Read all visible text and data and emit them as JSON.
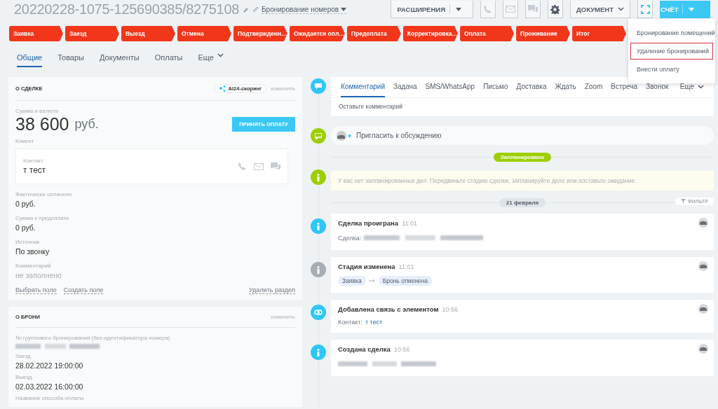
{
  "header": {
    "title": "20220228-1075-125690385/8275108",
    "category": "Бронирование номеров",
    "buttons": [
      {
        "kind": "split",
        "label": "РАСШИРЕНИЯ"
      },
      {
        "kind": "phone"
      },
      {
        "kind": "mail"
      },
      {
        "kind": "chat"
      },
      {
        "kind": "gear"
      },
      {
        "kind": "menu",
        "label": "ДОКУМЕНТ"
      },
      {
        "kind": "scan"
      },
      {
        "kind": "primary",
        "label": "СЧЁТ"
      }
    ]
  },
  "stages": [
    {
      "label": "Заявка"
    },
    {
      "label": "Заезд"
    },
    {
      "label": "Выезд"
    },
    {
      "label": "Отмена"
    },
    {
      "label": "Подтвержденн…"
    },
    {
      "label": "Ожидается опл…"
    },
    {
      "label": "Предоплата"
    },
    {
      "label": "Корректировка…"
    },
    {
      "label": "Оплата"
    },
    {
      "label": "Проживание"
    },
    {
      "label": "Итог"
    }
  ],
  "menu": [
    {
      "label": "Бронирование помещений",
      "selected": false
    },
    {
      "label": "Удаление бронирований",
      "selected": true
    },
    {
      "label": "Внести оплату",
      "selected": false
    }
  ],
  "tabs": [
    {
      "label": "Общие",
      "selected": true
    },
    {
      "label": "Товары",
      "selected": false
    },
    {
      "label": "Документы",
      "selected": false
    },
    {
      "label": "Оплаты",
      "selected": false
    },
    {
      "label": "Еще",
      "selected": false
    }
  ],
  "deal_card": {
    "title": "О СДЕЛКЕ",
    "scoring": "AI24-скоринг",
    "edit": "изменить",
    "amount_label": "Сумма и валюта",
    "amount": "38 600",
    "currency": "руб.",
    "pay_button": "ПРИНЯТЬ ОПЛАТУ",
    "client_label": "Клиент",
    "contact_label": "Контакт",
    "contact_name": "т тест",
    "fields": [
      {
        "label": "Фактически оплачено",
        "value": "0 руб.",
        "empty": false
      },
      {
        "label": "Сумма к предоплате",
        "value": "0 руб.",
        "empty": false
      },
      {
        "label": "Источник",
        "value": "По звонку",
        "empty": false
      },
      {
        "label": "Комментарий",
        "value": "не заполнено",
        "empty": true
      }
    ],
    "links": [
      "Выбрать поле",
      "Создать поле"
    ],
    "delete_link": "Удалить раздел"
  },
  "booking_card": {
    "title": "О БРОНИ",
    "edit": "изменить",
    "fields": [
      {
        "label": "№ группового бронирования (без идентификатора номера)",
        "blurred": true
      },
      {
        "label": "Заезд",
        "value": "28.02.2022 19:00:00"
      },
      {
        "label": "Выезд",
        "value": "02.03.2022 16:00:00"
      },
      {
        "label": "Название способа оплаты"
      }
    ]
  },
  "activity": {
    "tabs": [
      {
        "label": "Комментарий",
        "selected": true
      },
      {
        "label": "Задача",
        "selected": false
      },
      {
        "label": "SMS/WhatsApp",
        "selected": false
      },
      {
        "label": "Письмо",
        "selected": false
      },
      {
        "label": "Доставка",
        "selected": false
      },
      {
        "label": "Ждать",
        "selected": false
      },
      {
        "label": "Zoom",
        "selected": false
      },
      {
        "label": "Встреча",
        "selected": false
      },
      {
        "label": "Звонок",
        "selected": false
      },
      {
        "label": "Еще",
        "selected": false
      }
    ],
    "placeholder": "Оставьте комментарий",
    "invite": "Пригласить к обсуждению",
    "scheduled": "Запланировано",
    "notice": "У вас нет запланированных дел. Передвиньте стадию сделки, запланируйте дело или поставьте ожидание.",
    "date": "21 февраля",
    "filter": "ФИЛЬТР"
  },
  "events": [
    {
      "kind": "info",
      "color": "#2fc6f6",
      "title": "Сделка проиграна",
      "time": "11:01",
      "label": "Сделка:",
      "blurred": true
    },
    {
      "kind": "info",
      "color": "#a8adb4",
      "title": "Стадия изменена",
      "time": "11:01",
      "from": "Заявка",
      "to": "Бронь отменена"
    },
    {
      "kind": "link",
      "color": "#2fc6f6",
      "title": "Добавлена связь с элементом",
      "time": "10:56",
      "label": "Контакт:",
      "link": "т тест"
    },
    {
      "kind": "info",
      "color": "#2fc6f6",
      "title": "Создана сделка",
      "time": "10:56",
      "blurred": true
    }
  ]
}
